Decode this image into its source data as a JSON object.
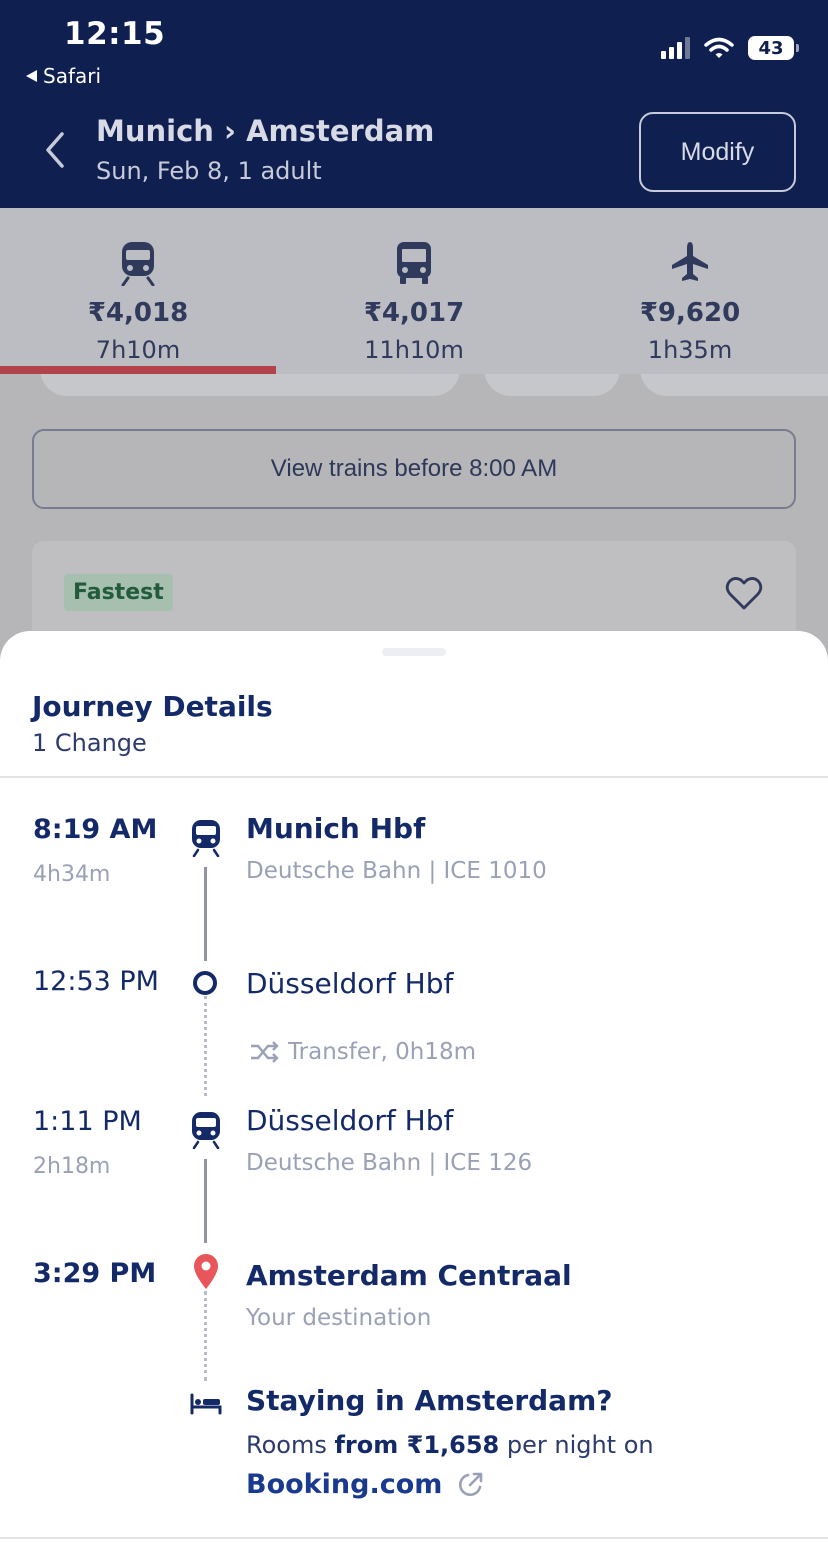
{
  "status_bar": {
    "time": "12:15",
    "back_app": "Safari",
    "battery": "43"
  },
  "header": {
    "route": "Munich › Amsterdam",
    "subtitle": "Sun, Feb 8, 1 adult",
    "modify_label": "Modify"
  },
  "modes": [
    {
      "icon": "train-icon",
      "price": "₹4,018",
      "duration": "7h10m",
      "selected": true
    },
    {
      "icon": "bus-icon",
      "price": "₹4,017",
      "duration": "11h10m",
      "selected": false
    },
    {
      "icon": "plane-icon",
      "price": "₹9,620",
      "duration": "1h35m",
      "selected": false
    }
  ],
  "results": {
    "view_earlier_label": "View trains before 8:00 AM",
    "card_badge": "Fastest"
  },
  "sheet": {
    "title": "Journey Details",
    "subtitle": "1 Change",
    "segments": [
      {
        "time": "8:19 AM",
        "duration": "4h34m",
        "station": "Munich Hbf",
        "operator": "Deutsche Bahn | ICE 1010"
      },
      {
        "time": "12:53 PM",
        "station": "Düsseldorf Hbf"
      },
      {
        "transfer": "Transfer, 0h18m"
      },
      {
        "time": "1:11 PM",
        "duration": "2h18m",
        "station": "Düsseldorf Hbf",
        "operator": "Deutsche Bahn | ICE 126"
      },
      {
        "time": "3:29 PM",
        "station": "Amsterdam Centraal",
        "note": "Your destination"
      }
    ],
    "stay": {
      "title": "Staying in Amsterdam?",
      "prefix": "Rooms ",
      "price": "from ₹1,658",
      "suffix": " per night on",
      "link": "Booking.com"
    }
  },
  "colors": {
    "navy": "#0f1f4f",
    "text_primary": "#132968",
    "muted": "#9aa1b6",
    "accent_red": "#e8555a",
    "fastest_green": "#235c3b"
  }
}
